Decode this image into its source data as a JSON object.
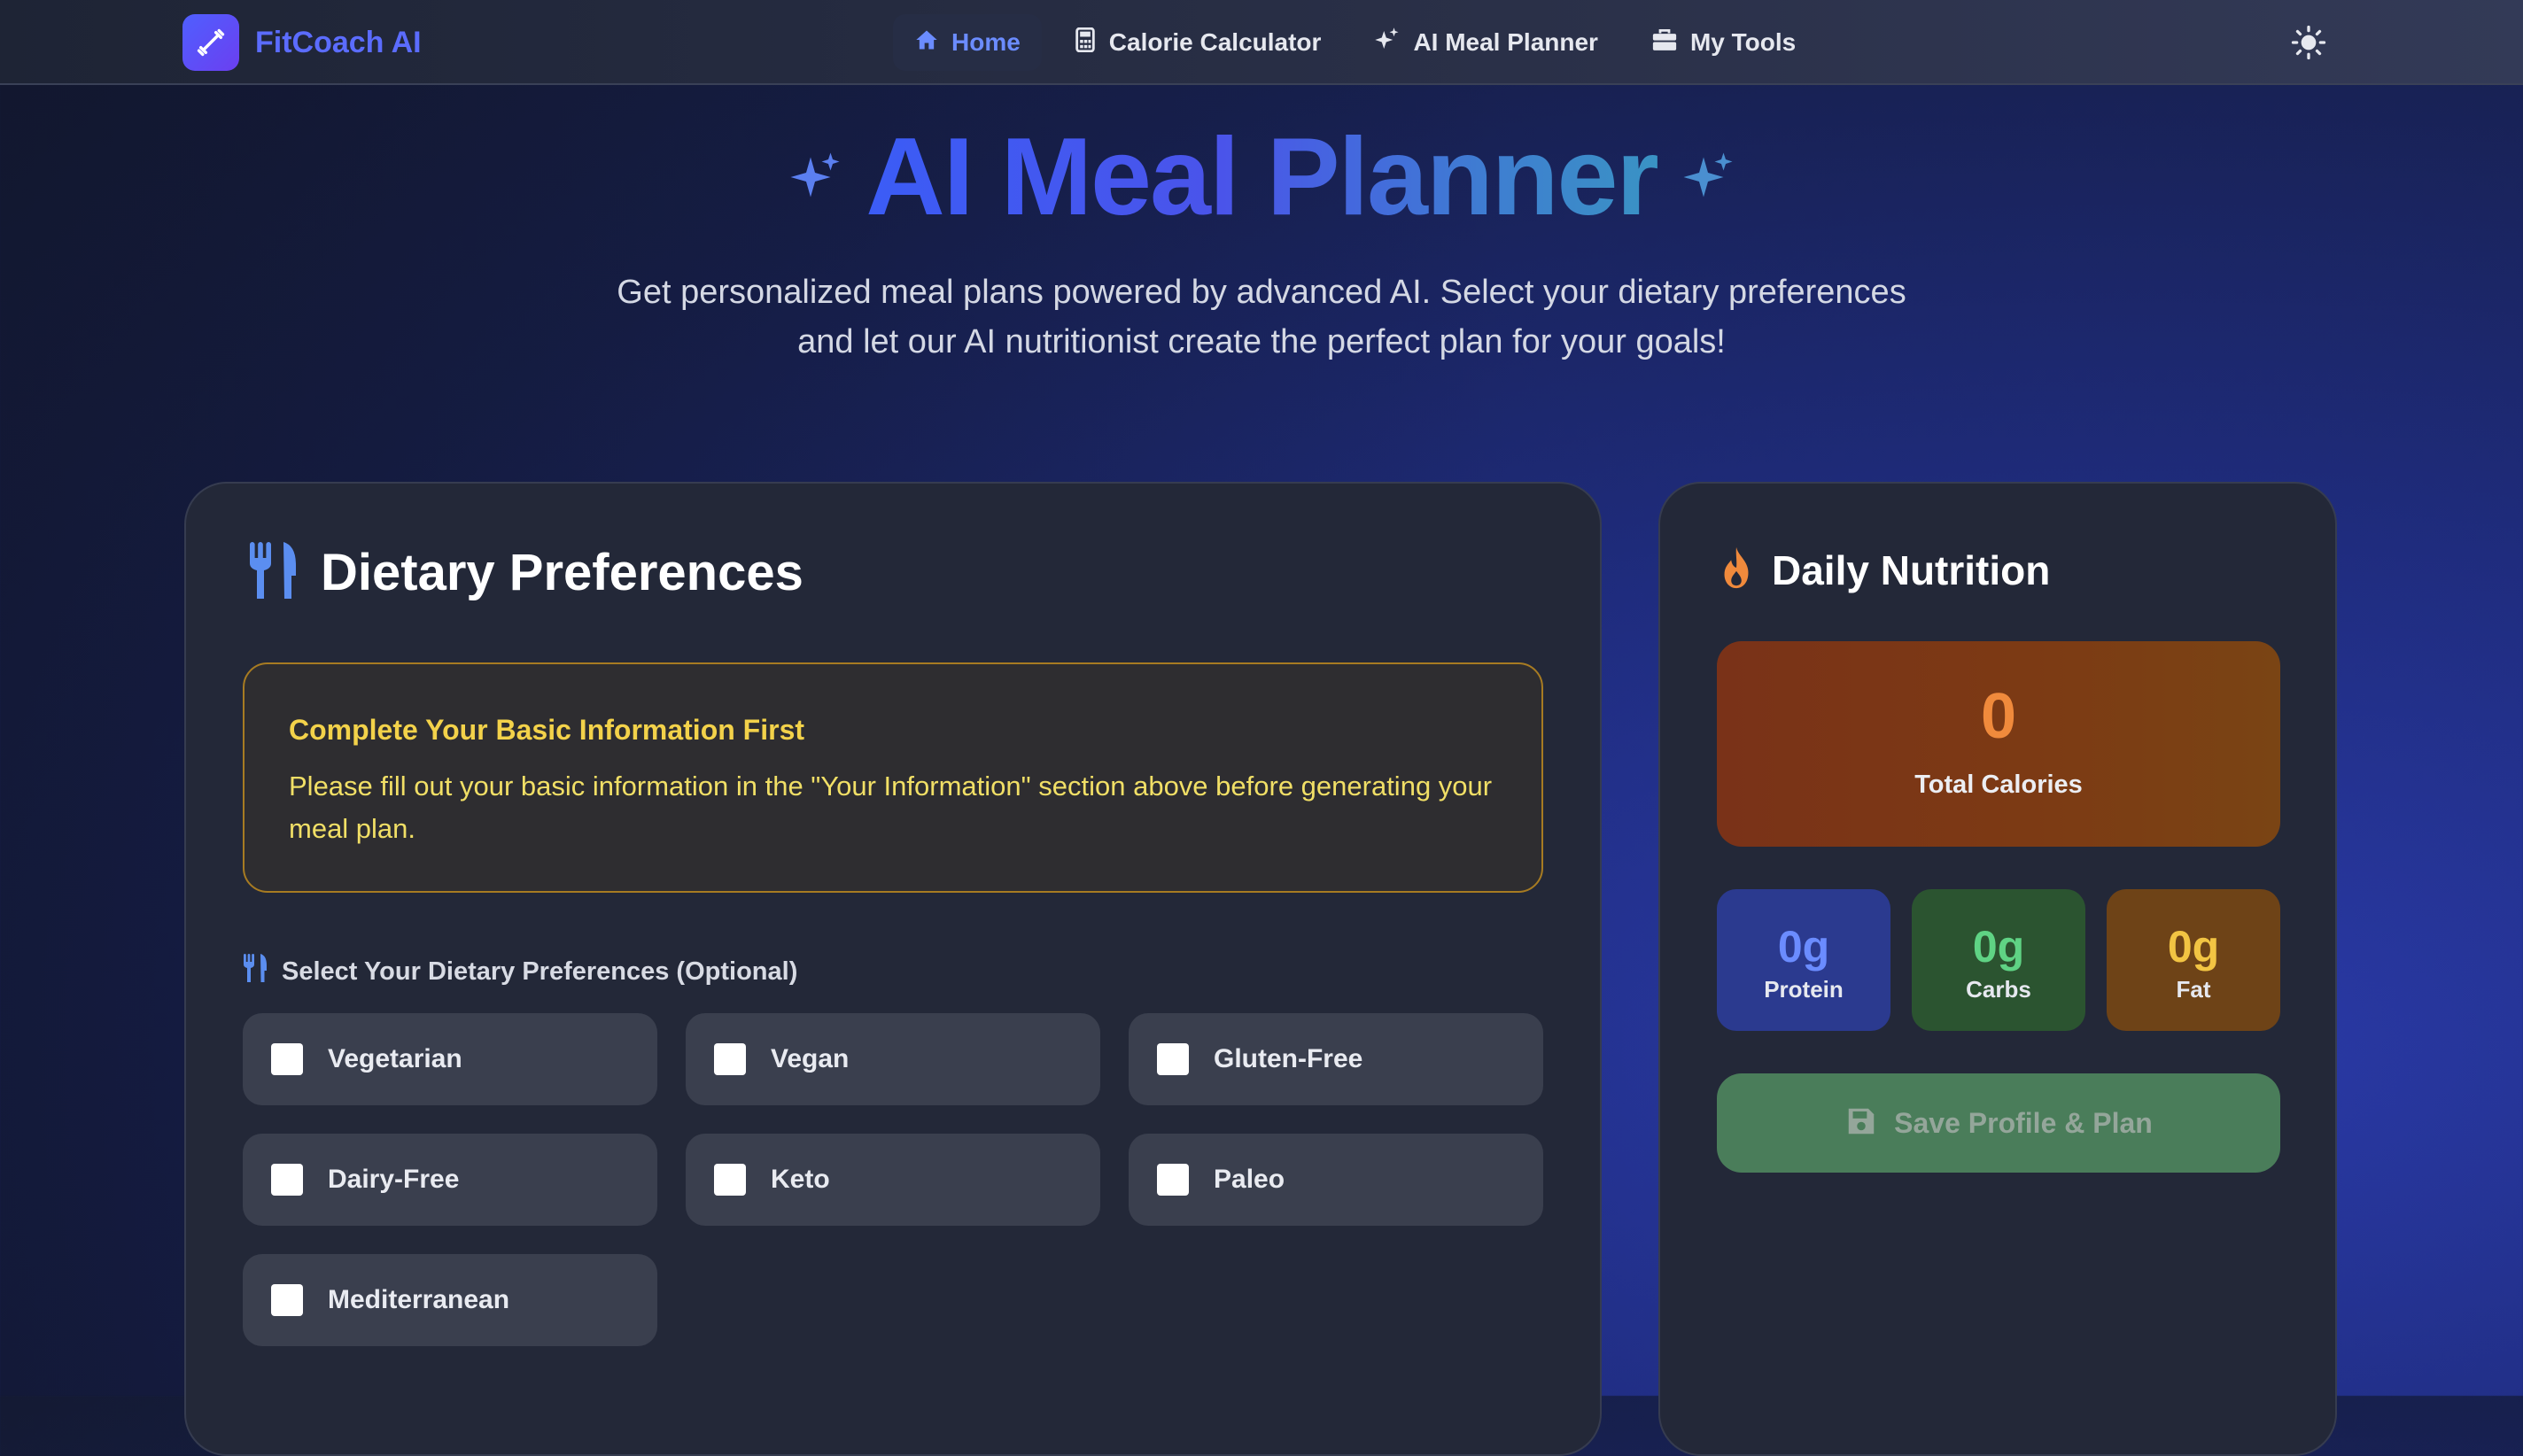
{
  "app": {
    "name": "FitCoach AI"
  },
  "nav": {
    "items": [
      {
        "label": "Home",
        "icon": "home-icon",
        "active": true
      },
      {
        "label": "Calorie Calculator",
        "icon": "calculator-icon",
        "active": false
      },
      {
        "label": "AI Meal Planner",
        "icon": "sparkles-icon",
        "active": false
      },
      {
        "label": "My Tools",
        "icon": "toolbox-icon",
        "active": false
      }
    ],
    "theme_toggle_icon": "sun-icon"
  },
  "hero": {
    "title": "AI Meal Planner",
    "subtitle_line1": "Get personalized meal plans powered by advanced AI. Select your dietary preferences",
    "subtitle_line2": "and let our AI nutritionist create the perfect plan for your goals!"
  },
  "preferences": {
    "heading": "Dietary Preferences",
    "alert": {
      "title": "Complete Your Basic Information First",
      "body": "Please fill out your basic information in the \"Your Information\" section above before generating your meal plan."
    },
    "select_label": "Select Your Dietary Preferences (Optional)",
    "options": [
      {
        "label": "Vegetarian",
        "checked": false
      },
      {
        "label": "Vegan",
        "checked": false
      },
      {
        "label": "Gluten-Free",
        "checked": false
      },
      {
        "label": "Dairy-Free",
        "checked": false
      },
      {
        "label": "Keto",
        "checked": false
      },
      {
        "label": "Paleo",
        "checked": false
      },
      {
        "label": "Mediterranean",
        "checked": false
      }
    ]
  },
  "nutrition": {
    "heading": "Daily Nutrition",
    "total_calories": {
      "value": "0",
      "label": "Total Calories"
    },
    "macros": [
      {
        "value": "0g",
        "label": "Protein"
      },
      {
        "value": "0g",
        "label": "Carbs"
      },
      {
        "value": "0g",
        "label": "Fat"
      }
    ],
    "save_button": "Save Profile & Plan"
  },
  "colors": {
    "accent": "#5b6cff",
    "protein_bg": "#2b3a8f",
    "carbs_bg": "#2b5430",
    "fat_bg": "#6e4317",
    "save_bg": "#4a7d5a",
    "alert_border": "#a77b22"
  }
}
